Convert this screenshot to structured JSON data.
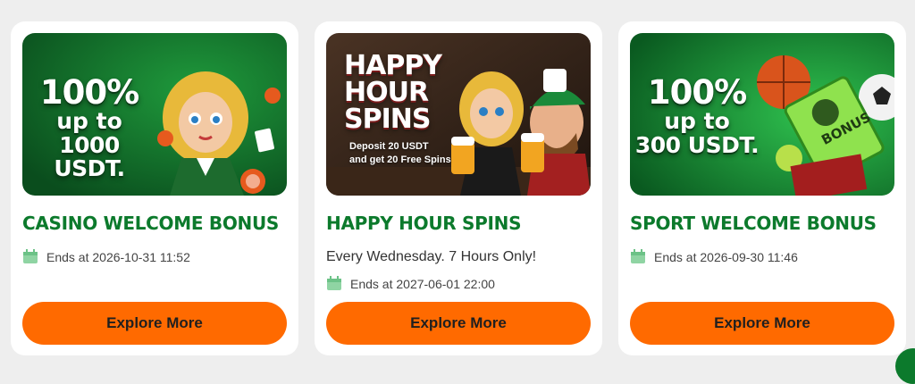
{
  "cards": [
    {
      "banner": {
        "line1": "100%",
        "line2": "up to",
        "line3": "1000 USDT."
      },
      "title": "CASINO WELCOME BONUS",
      "description": "",
      "ends": "Ends at 2026-10-31 11:52",
      "button": "Explore More"
    },
    {
      "banner": {
        "title_line1": "HAPPY",
        "title_line2": "HOUR",
        "title_line3": "SPINS",
        "sub1": "Deposit 20 USDT",
        "sub2": "and get 20 Free Spins"
      },
      "title": "HAPPY HOUR SPINS",
      "description": "Every Wednesday. 7 Hours Only!",
      "ends": "Ends at 2027-06-01 22:00",
      "button": "Explore More"
    },
    {
      "banner": {
        "line1": "100%",
        "line2": "up to",
        "line3": "300 USDT.",
        "ticket": "BONUS"
      },
      "title": "SPORT WELCOME BONUS",
      "description": "",
      "ends": "Ends at 2026-09-30 11:46",
      "button": "Explore More"
    }
  ],
  "colors": {
    "title_green": "#0c7a2c",
    "button_orange": "#ff6a00",
    "calendar_icon": "#8fd4a3"
  }
}
